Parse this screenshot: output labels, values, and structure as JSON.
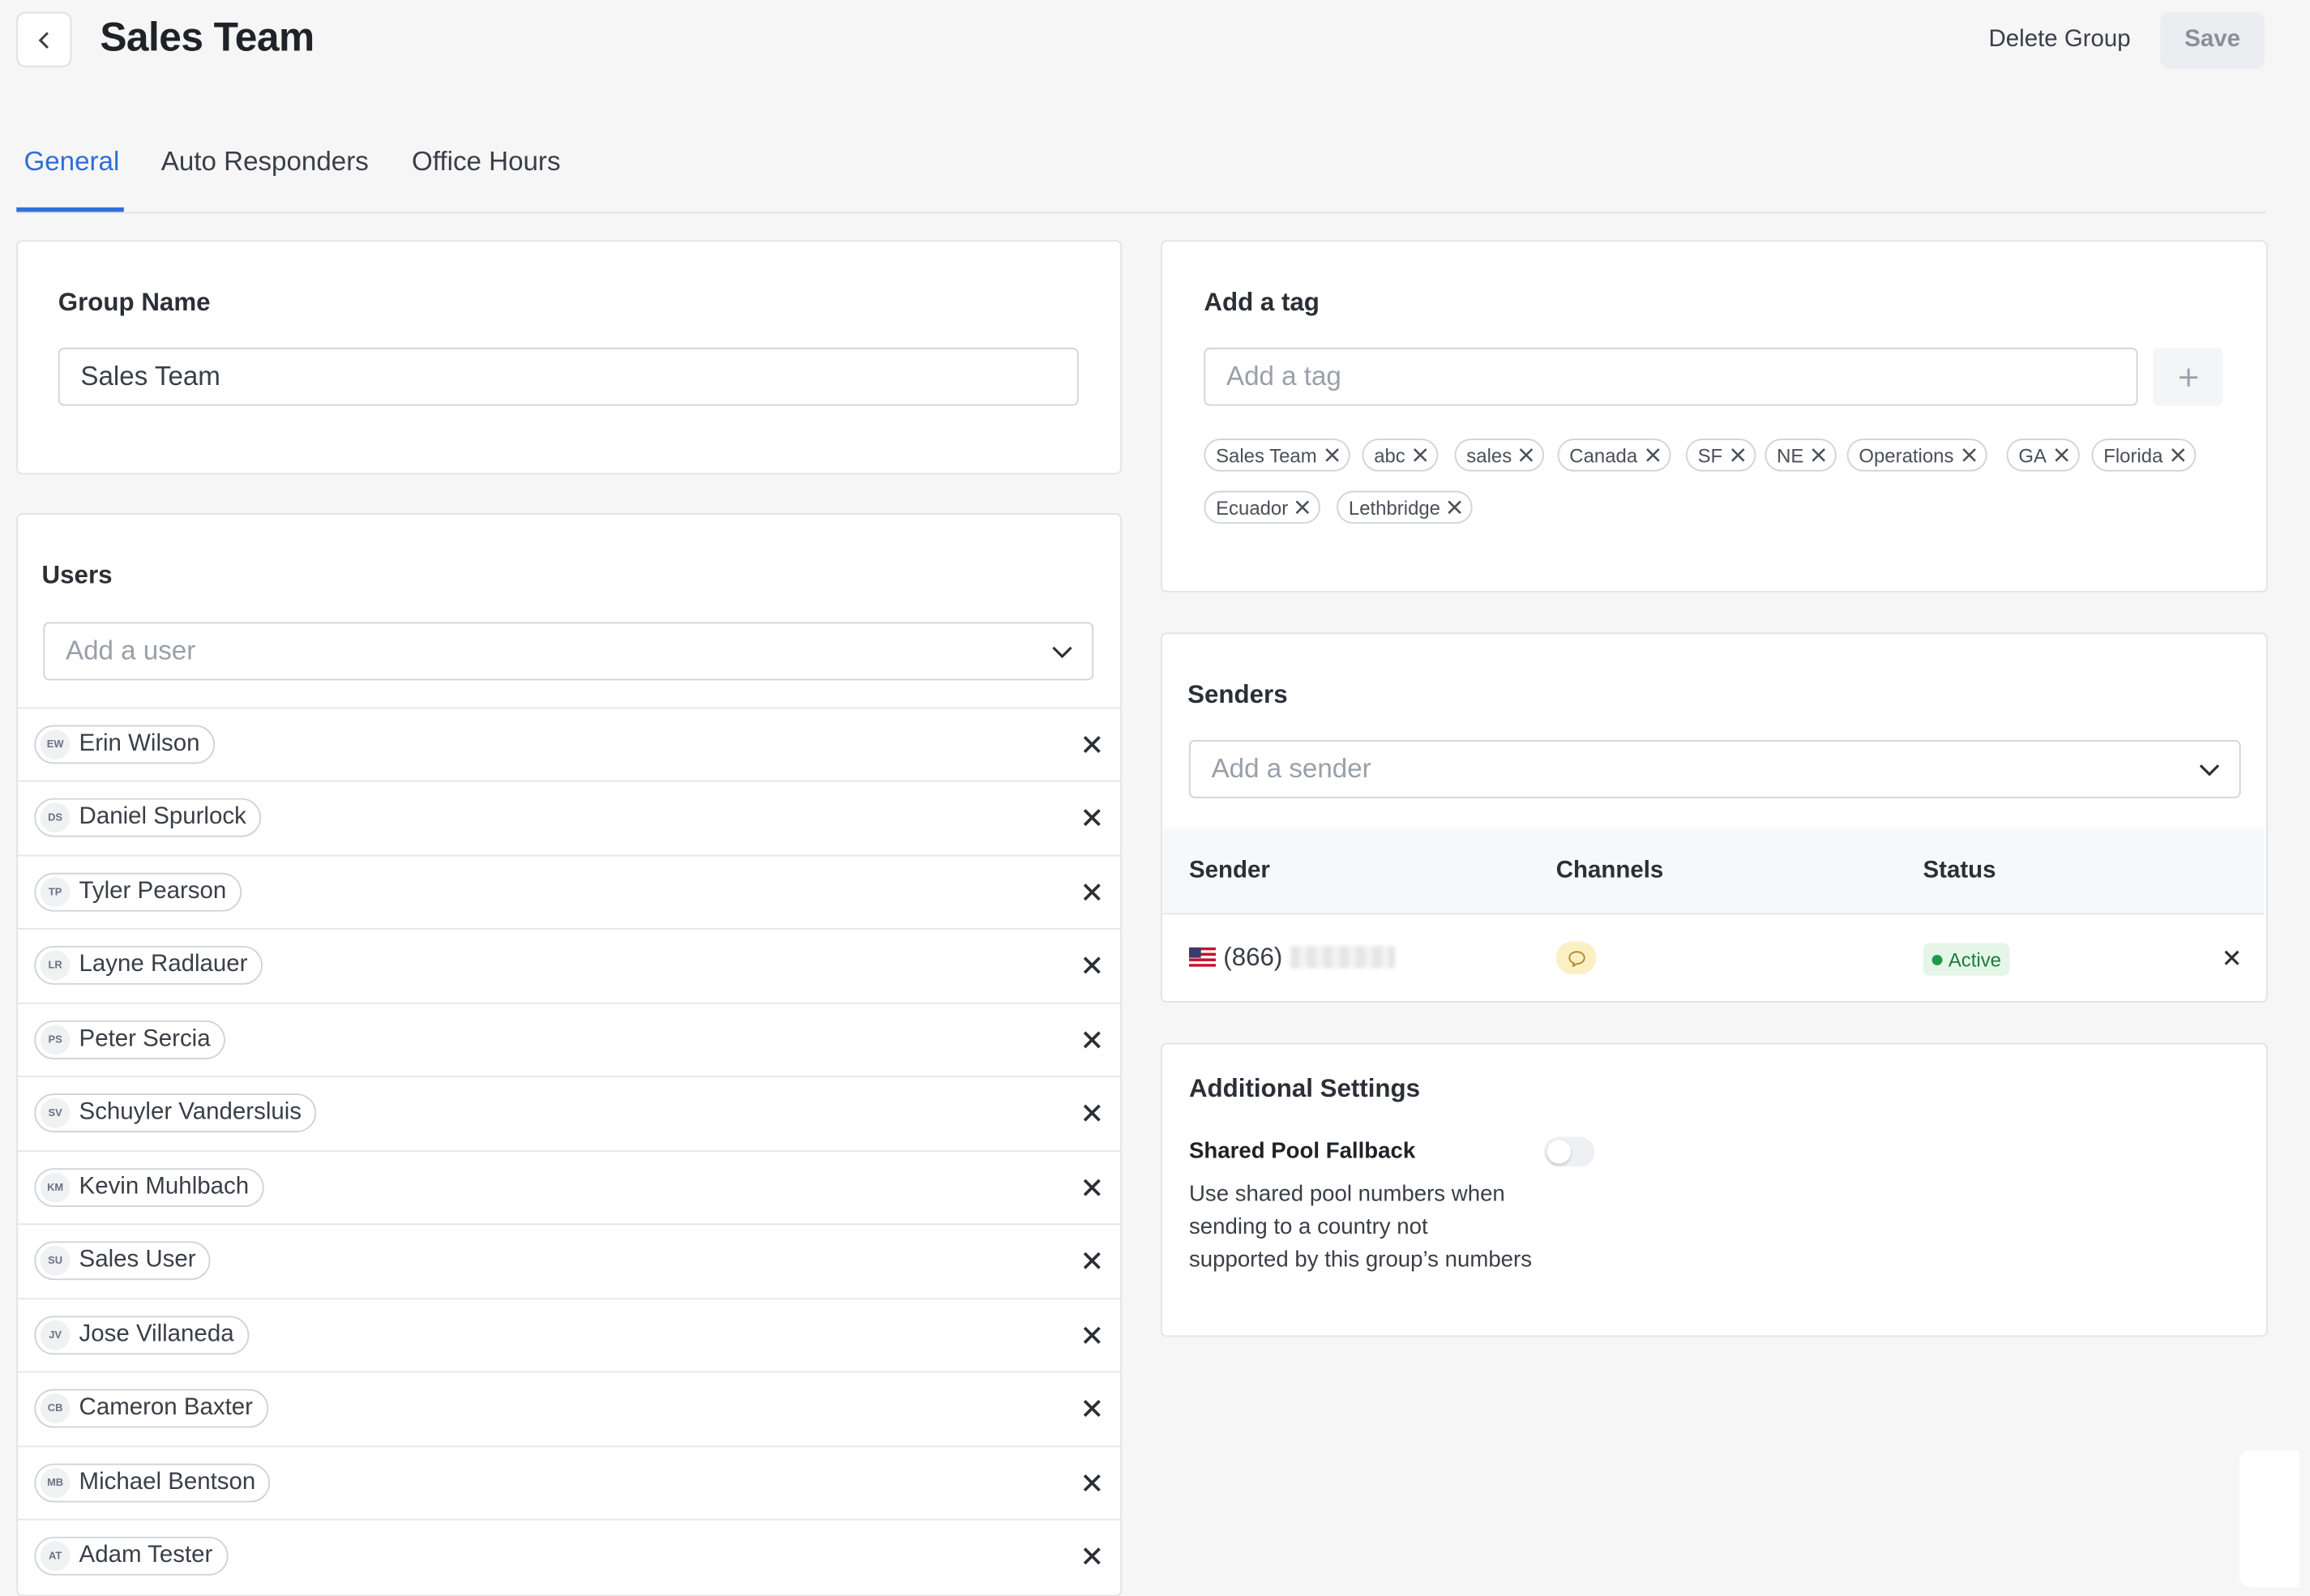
{
  "header": {
    "title": "Sales Team",
    "delete_label": "Delete Group",
    "save_label": "Save"
  },
  "tabs": [
    {
      "label": "General",
      "active": true
    },
    {
      "label": "Auto Responders",
      "active": false
    },
    {
      "label": "Office Hours",
      "active": false
    }
  ],
  "group_name": {
    "title": "Group Name",
    "value": "Sales Team"
  },
  "users": {
    "title": "Users",
    "add_placeholder": "Add a user",
    "items": [
      {
        "initials": "EW",
        "name": "Erin Wilson"
      },
      {
        "initials": "DS",
        "name": "Daniel Spurlock"
      },
      {
        "initials": "TP",
        "name": "Tyler Pearson"
      },
      {
        "initials": "LR",
        "name": "Layne Radlauer"
      },
      {
        "initials": "PS",
        "name": "Peter Sercia"
      },
      {
        "initials": "SV",
        "name": "Schuyler Vandersluis"
      },
      {
        "initials": "KM",
        "name": "Kevin Muhlbach"
      },
      {
        "initials": "SU",
        "name": "Sales User"
      },
      {
        "initials": "JV",
        "name": "Jose Villaneda"
      },
      {
        "initials": "CB",
        "name": "Cameron Baxter"
      },
      {
        "initials": "MB",
        "name": "Michael Bentson"
      },
      {
        "initials": "AT",
        "name": "Adam Tester"
      }
    ]
  },
  "tags": {
    "title": "Add a tag",
    "placeholder": "Add a tag",
    "items": [
      "Sales Team",
      "abc",
      "sales",
      "Canada",
      "SF",
      "NE",
      "Operations",
      "GA",
      "Florida",
      "Ecuador",
      "Lethbridge"
    ]
  },
  "senders": {
    "title": "Senders",
    "add_placeholder": "Add a sender",
    "columns": [
      "Sender",
      "Channels",
      "Status"
    ],
    "rows": [
      {
        "country": "US",
        "phone_prefix": "(866)",
        "channel_icon": "chat-bubble-icon",
        "status": "Active"
      }
    ]
  },
  "additional_settings": {
    "title": "Additional Settings",
    "shared_pool_label": "Shared Pool Fallback",
    "shared_pool_description": "Use shared pool numbers when sending to a country not supported by this group’s numbers",
    "shared_pool_enabled": false
  },
  "colors": {
    "accent": "#2f6fd6",
    "status_active": "#1f9a48",
    "status_bg": "#e5f6e9",
    "channel_bg": "#fbefc4"
  }
}
